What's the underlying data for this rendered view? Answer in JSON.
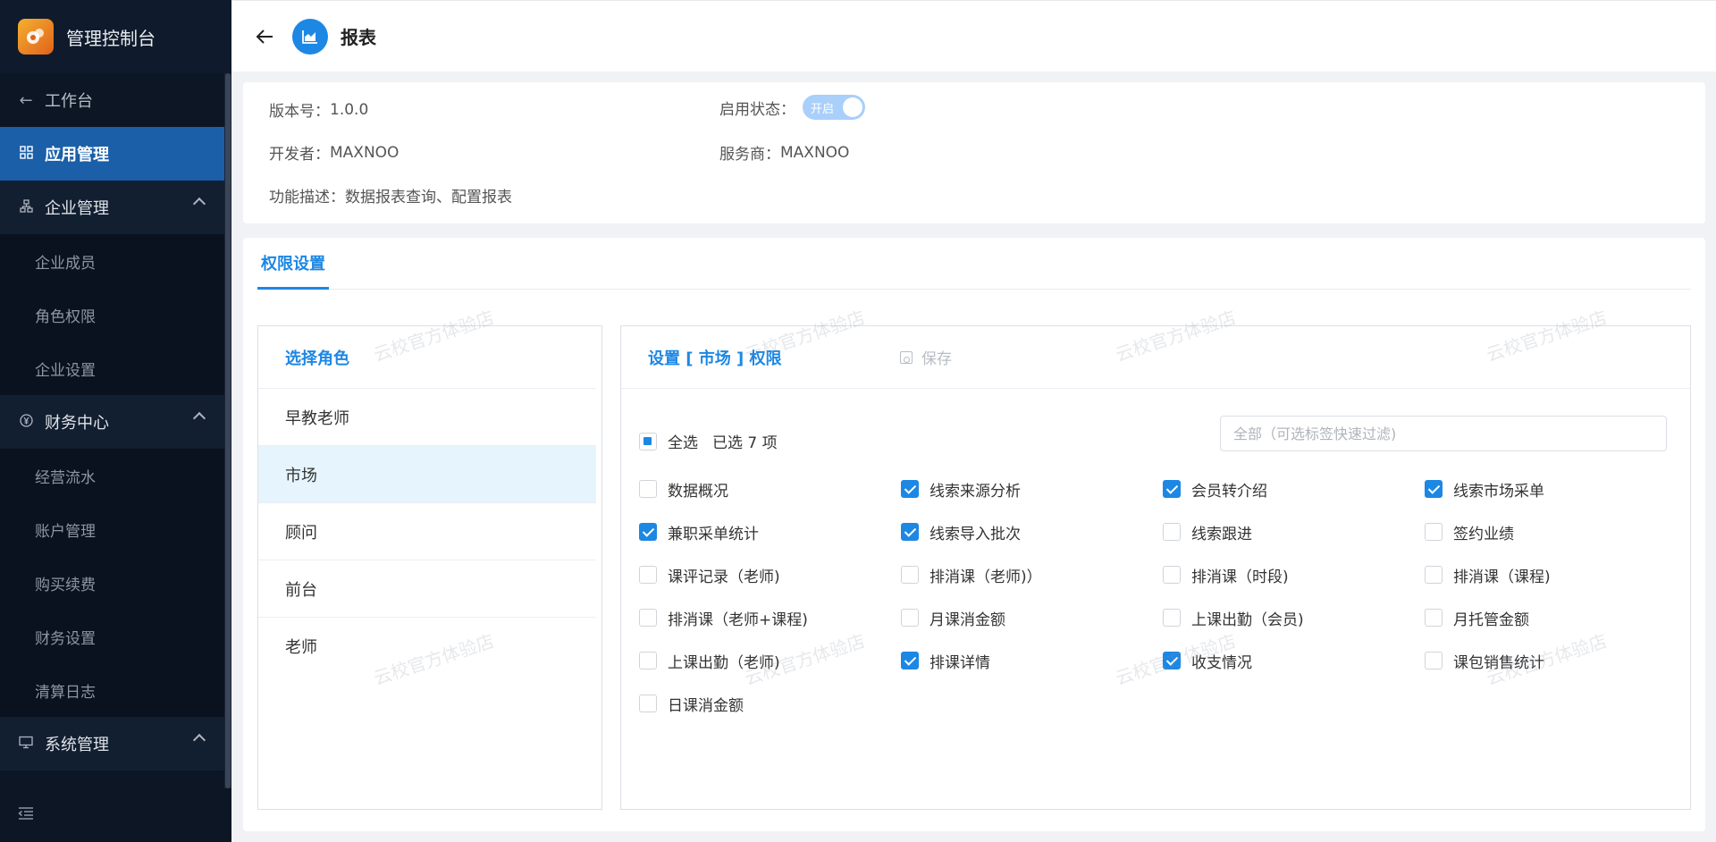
{
  "sidebar": {
    "brand_title": "管理控制台",
    "back_label": "工作台",
    "app_mgmt_label": "应用管理",
    "groups": {
      "enterprise": {
        "label": "企业管理",
        "items": [
          "企业成员",
          "角色权限",
          "企业设置"
        ]
      },
      "finance": {
        "label": "财务中心",
        "items": [
          "经营流水",
          "账户管理",
          "购买续费",
          "财务设置",
          "清算日志"
        ]
      },
      "system": {
        "label": "系统管理"
      }
    }
  },
  "header": {
    "title": "报表"
  },
  "info": {
    "version_label": "版本号：",
    "version_value": "1.0.0",
    "status_label": "启用状态：",
    "toggle_text": "开启",
    "developer_label": "开发者：",
    "developer_value": "MAXNOO",
    "provider_label": "服务商：",
    "provider_value": "MAXNOO",
    "desc_label": "功能描述：",
    "desc_value": "数据报表查询、配置报表"
  },
  "permission": {
    "tab_label": "权限设置",
    "roles_title": "选择角色",
    "roles": [
      "早教老师",
      "市场",
      "顾问",
      "前台",
      "老师"
    ],
    "selected_role": "市场",
    "settings_title": "设置 [ 市场 ] 权限",
    "save_label": "保存",
    "select_all_label": "全选",
    "selected_count_text": "已选 7 项",
    "filter_placeholder": "全部（可选标签快速过滤)",
    "items": [
      {
        "label": "数据概况",
        "checked": false
      },
      {
        "label": "线索来源分析",
        "checked": true
      },
      {
        "label": "会员转介绍",
        "checked": true
      },
      {
        "label": "线索市场采单",
        "checked": true
      },
      {
        "label": "兼职采单统计",
        "checked": true
      },
      {
        "label": "线索导入批次",
        "checked": true
      },
      {
        "label": "线索跟进",
        "checked": false
      },
      {
        "label": "签约业绩",
        "checked": false
      },
      {
        "label": "课评记录（老师)",
        "checked": false
      },
      {
        "label": "排消课（老师)）",
        "checked": false
      },
      {
        "label": "排消课（时段)",
        "checked": false
      },
      {
        "label": "排消课（课程)",
        "checked": false
      },
      {
        "label": "排消课（老师+课程)",
        "checked": false
      },
      {
        "label": "月课消金额",
        "checked": false
      },
      {
        "label": "上课出勤（会员)",
        "checked": false
      },
      {
        "label": "月托管金额",
        "checked": false
      },
      {
        "label": "上课出勤（老师)",
        "checked": false
      },
      {
        "label": "排课详情",
        "checked": true
      },
      {
        "label": "收支情况",
        "checked": true
      },
      {
        "label": "课包销售统计",
        "checked": false
      },
      {
        "label": "日课消金额",
        "checked": false
      }
    ],
    "watermark_text": "云校官方体验店"
  },
  "colors": {
    "accent": "#1d87e4",
    "sidebar_bg": "#0c1625",
    "sidebar_active": "#1a5fa8",
    "selected_row": "#e6f4fd"
  },
  "icons": {
    "brand": "brand-logo-icon",
    "back": "arrow-left-icon",
    "app_mgmt": "grid-icon",
    "enterprise": "org-icon",
    "finance": "yen-icon",
    "system": "monitor-icon",
    "collapse": "menu-fold-icon",
    "report": "area-chart-icon",
    "save": "save-icon"
  }
}
